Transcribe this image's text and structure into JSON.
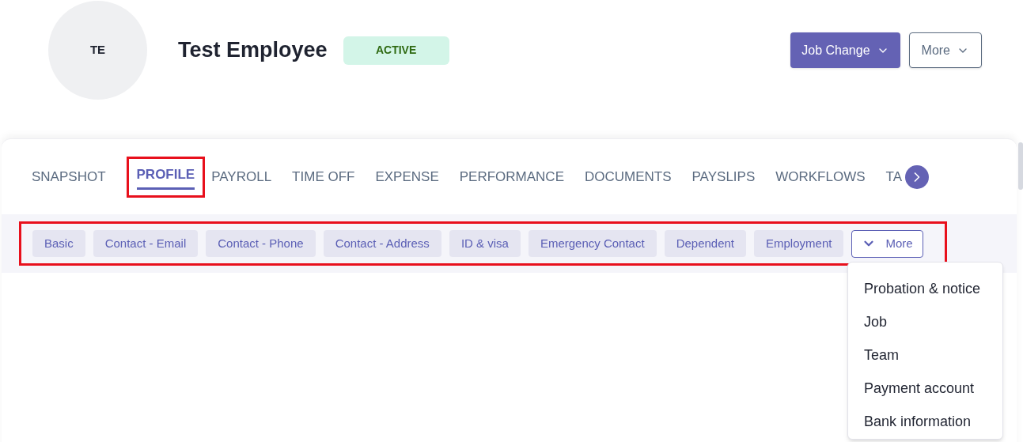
{
  "employee": {
    "initials": "TE",
    "name": "Test Employee",
    "status": "ACTIVE"
  },
  "actions": [
    {
      "label": "Job Change",
      "kind": "primary"
    },
    {
      "label": "More",
      "kind": "outline"
    }
  ],
  "tabs": [
    {
      "label": "SNAPSHOT",
      "selected": false,
      "highlighted": false
    },
    {
      "label": "PROFILE",
      "selected": true,
      "highlighted": true
    },
    {
      "label": "PAYROLL",
      "selected": false,
      "highlighted": false
    },
    {
      "label": "TIME OFF",
      "selected": false,
      "highlighted": false
    },
    {
      "label": "EXPENSE",
      "selected": false,
      "highlighted": false
    },
    {
      "label": "PERFORMANCE",
      "selected": false,
      "highlighted": false
    },
    {
      "label": "DOCUMENTS",
      "selected": false,
      "highlighted": false
    },
    {
      "label": "PAYSLIPS",
      "selected": false,
      "highlighted": false
    },
    {
      "label": "WORKFLOWS",
      "selected": false,
      "highlighted": false
    },
    {
      "label": "TA",
      "selected": false,
      "highlighted": false
    }
  ],
  "sections": {
    "highlighted": true,
    "items": [
      "Basic",
      "Contact - Email",
      "Contact - Phone",
      "Contact - Address",
      "ID & visa",
      "Emergency Contact",
      "Dependent",
      "Employment"
    ],
    "more": {
      "label": "More",
      "expanded": true,
      "menu": [
        "Probation & notice",
        "Job",
        "Team",
        "Payment account",
        "Bank information"
      ]
    }
  }
}
